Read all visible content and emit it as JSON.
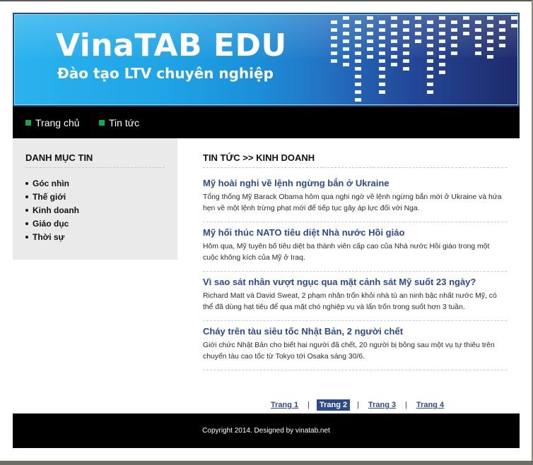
{
  "banner": {
    "title": "VinaTAB EDU",
    "subtitle": "Đào tạo LTV chuyên nghiệp"
  },
  "nav": {
    "items": [
      {
        "label": "Trang chủ"
      },
      {
        "label": "Tin tức"
      }
    ],
    "bullet_color": "#19a54a"
  },
  "sidebar": {
    "title": "DANH MỤC TIN",
    "items": [
      {
        "label": "Góc nhìn"
      },
      {
        "label": "Thế giới"
      },
      {
        "label": "Kinh doanh"
      },
      {
        "label": "Giáo dục"
      },
      {
        "label": "Thời sự"
      }
    ]
  },
  "main": {
    "title": "TIN TỨC >> KINH DOANH",
    "articles": [
      {
        "title": "Mỹ hoài nghi về lệnh ngừng bắn ở Ukraine",
        "summary": "Tổng thống Mỹ Barack Obama hôm qua nghi ngờ về lệnh ngừng bắn mới ở Ukraine và hứa hẹn về một lệnh trừng phạt mới để tiếp tục gây áp lực đối với Nga."
      },
      {
        "title": "Mỹ hối thúc NATO tiêu diệt Nhà nước Hồi giáo",
        "summary": "Hôm qua, Mỹ tuyên bố tiêu diệt ba thành viên cấp cao của Nhà nước Hồi giáo trong một cuộc không kích của Mỹ ở Iraq."
      },
      {
        "title": "Vì sao sát nhân vượt ngục qua mặt cảnh sát Mỹ suốt 23 ngày?",
        "summary": "Richard Matt và David Sweat, 2 phạm nhân trốn khỏi nhà tù an ninh bậc nhất nước Mỹ, có thể đã dùng hạt tiêu để qua mặt chó nghiệp vụ và lẩn trốn trong suốt hơn 3 tuần."
      },
      {
        "title": "Cháy trên tàu siêu tốc Nhật Bản, 2 người chết",
        "summary": "Giới chức Nhật Bản cho biết hai người đã chết, 20 người bị bỏng sau một vụ tự thiêu trên chuyến tàu cao tốc từ Tokyo tới Osaka sáng 30/6."
      }
    ]
  },
  "pagination": {
    "pages": [
      {
        "label": "Trang 1",
        "active": false
      },
      {
        "label": "Trang 2",
        "active": true
      },
      {
        "label": "Trang 3",
        "active": false
      },
      {
        "label": "Trang 4",
        "active": false
      }
    ],
    "separator": "|",
    "active_color": "#2d4a8a"
  },
  "footer": {
    "text": "Copyright 2014. Designed by vinatab.net"
  },
  "colors": {
    "link": "#2d4a8a",
    "nav_bg": "#000000",
    "sidebar_bg": "#eaeaea"
  }
}
